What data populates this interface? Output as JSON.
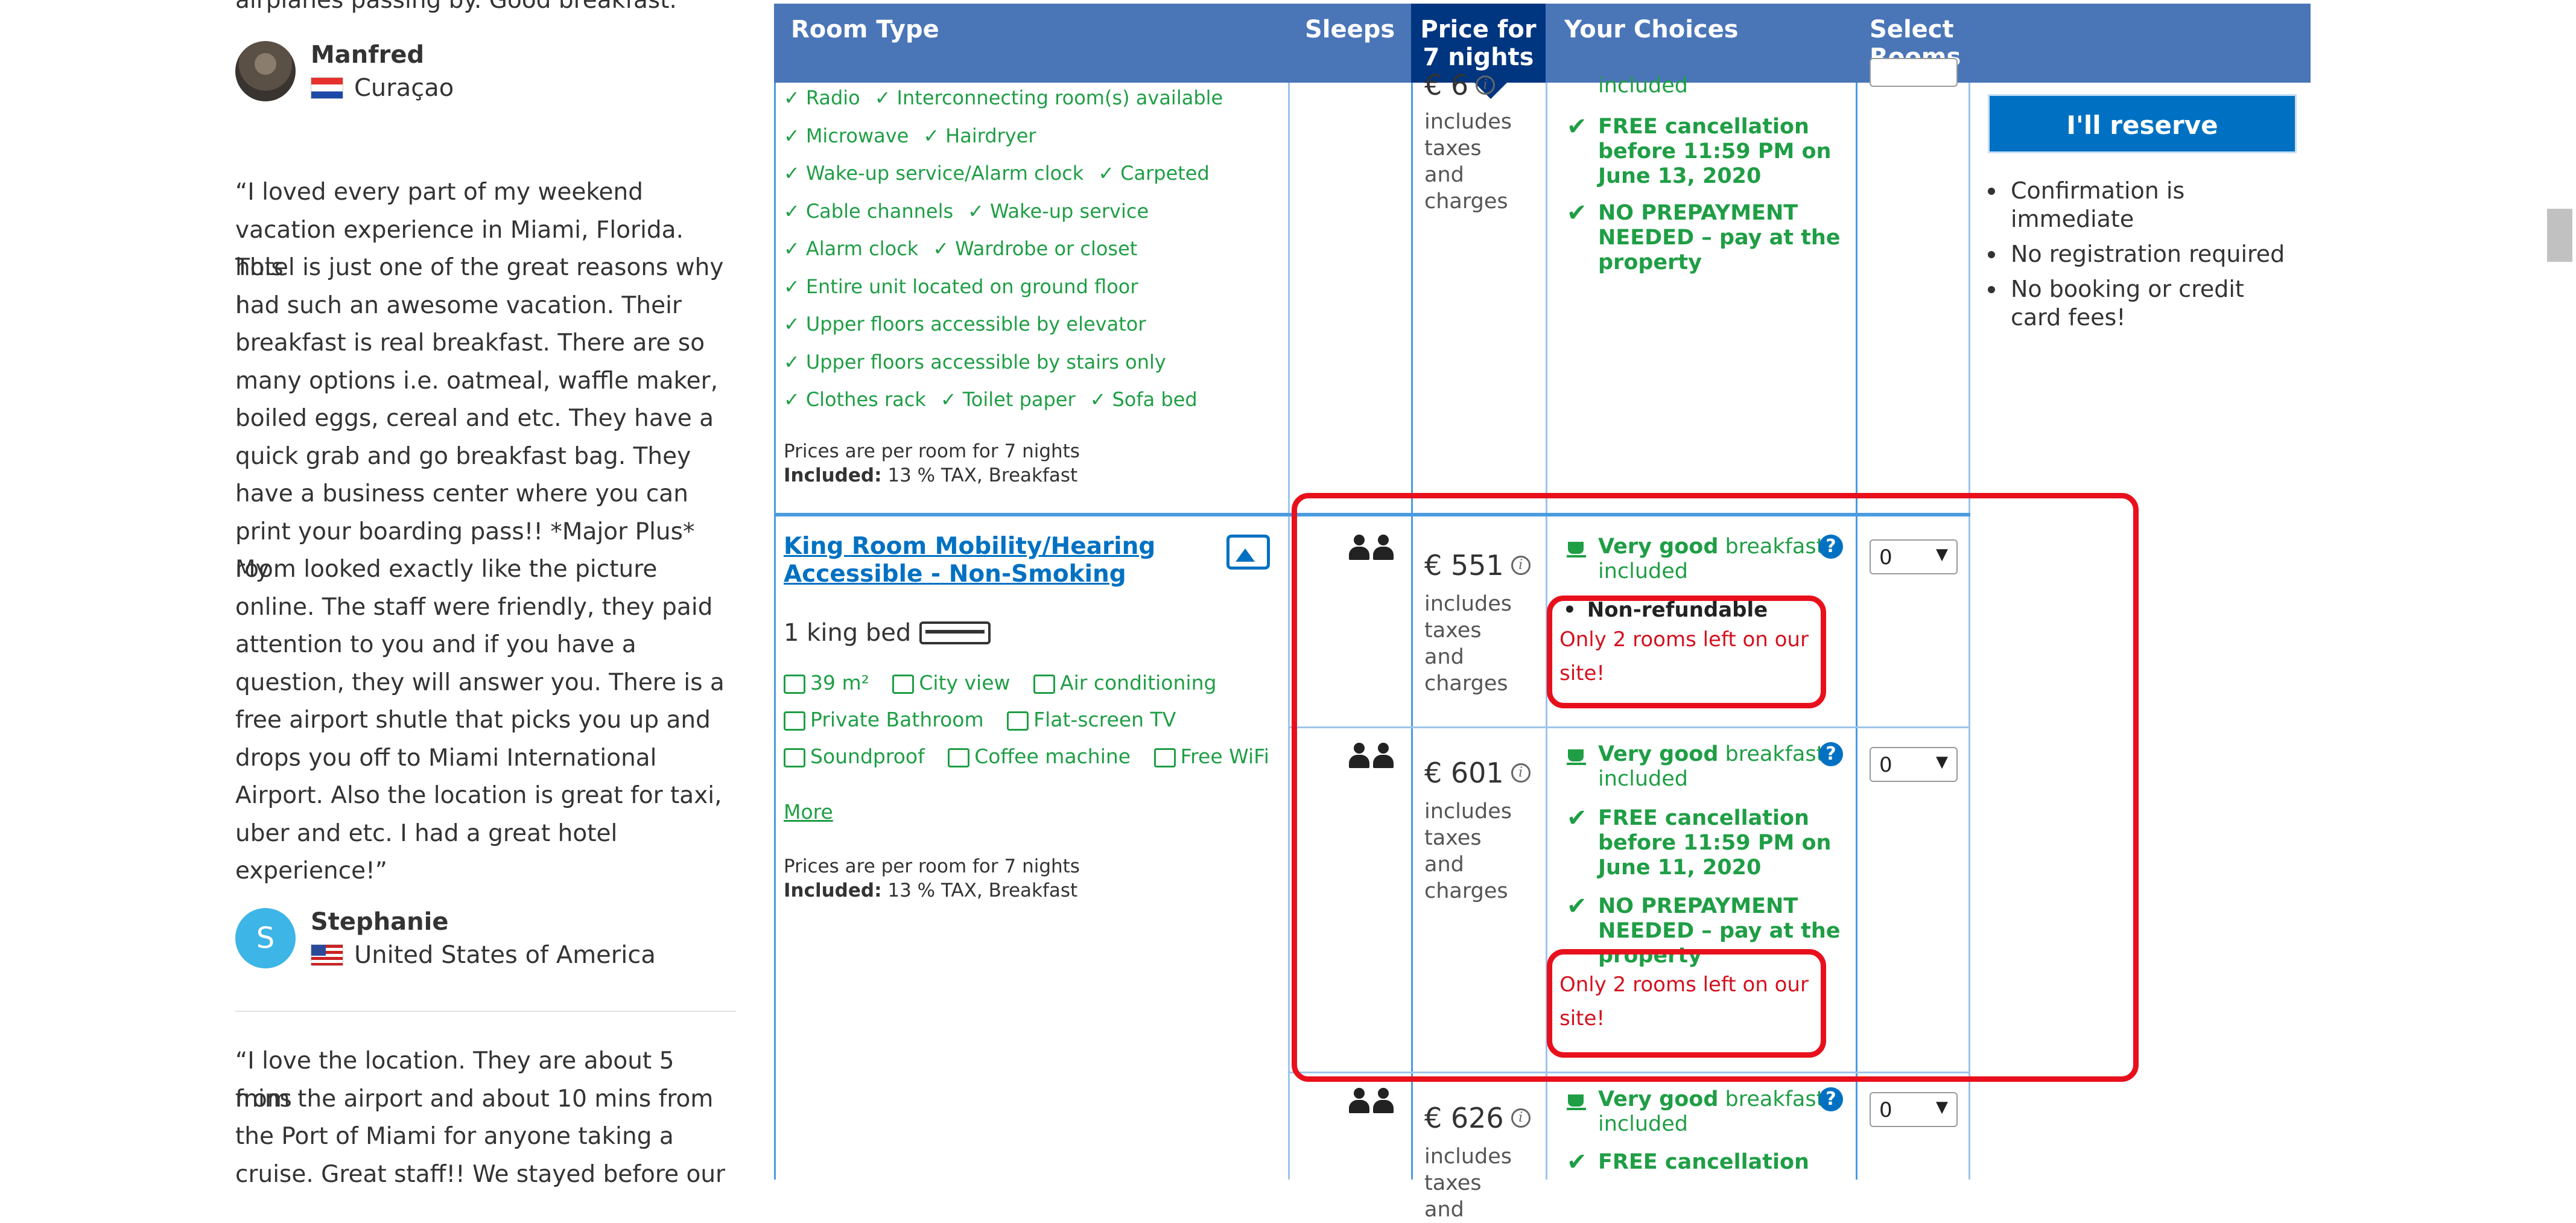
{
  "reviews": {
    "cut_text_top": "airplanes passing by. Good breakfast.",
    "reviewer1": {
      "name": "Manfred",
      "country": "Curaçao"
    },
    "review2_lines": [
      "“I loved every part of my weekend",
      "vacation experience in Miami, Florida. This",
      "hotel is just one of the great reasons why I",
      "had such an awesome vacation. Their",
      "breakfast is real breakfast. There are so",
      "many options i.e. oatmeal, waffle maker,",
      "boiled eggs, cereal and etc. They have a",
      "quick grab and go breakfast bag. They",
      "have a business center where you can",
      "print your boarding pass!! *Major Plus* My",
      "room looked exactly like the picture",
      "online. The staff were friendly, they paid",
      "attention to you and if you have a",
      "question, they will answer you. There is a",
      "free airport shutle that picks you up and",
      "drops you off to Miami International",
      "Airport. Also the location is great for taxi,",
      "uber and etc. I had a great hotel",
      "experience!”"
    ],
    "reviewer2": {
      "name": "Stephanie",
      "initial": "S",
      "country": "United States of America"
    },
    "review3_lines": [
      "“I love the location. They are about 5 mins",
      "from the airport and about 10 mins from",
      "the Port of Miami for anyone taking a",
      "cruise. Great staff!! We stayed before our"
    ]
  },
  "table": {
    "headers": {
      "room_type": "Room Type",
      "sleeps": "Sleeps",
      "price_line1": "Price for",
      "price_line2": "7 nights",
      "choices": "Your Choices",
      "select_line1": "Select",
      "select_line2": "Rooms"
    },
    "room1": {
      "price_partial": "€ 6",
      "included_partial": "included",
      "facility_rows": [
        [
          "Radio",
          "Interconnecting room(s) available"
        ],
        [
          "Microwave",
          "Hairdryer"
        ],
        [
          "Wake-up service/Alarm clock",
          "Carpeted"
        ],
        [
          "Cable channels",
          "Wake-up service"
        ],
        [
          "Alarm clock",
          "Wardrobe or closet"
        ],
        [
          "Entire unit located on ground floor"
        ],
        [
          "Upper floors accessible by elevator"
        ],
        [
          "Upper floors accessible by stairs only"
        ],
        [
          "Clothes rack",
          "Toilet paper",
          "Sofa bed"
        ]
      ],
      "prices_note": "Prices are per room for 7 nights",
      "included_label": "Included:",
      "included_value": "13 % TAX, Breakfast",
      "incl_text": "includes taxes and charges",
      "free_cancel": "FREE cancellation before 11:59 PM on June 13, 2020",
      "no_prepay": "NO PREPAYMENT NEEDED",
      "no_prepay_tail": " – pay at the property"
    },
    "room2": {
      "name": "King Room Mobility/Hearing Accessible - Non-Smoking",
      "bed": "1 king bed",
      "features_row1": [
        "39 m²",
        "City view",
        "Air conditioning"
      ],
      "features_row2": [
        "Private Bathroom",
        "Flat-screen TV"
      ],
      "features_row3": [
        "Soundproof",
        "Coffee machine",
        "Free WiFi"
      ],
      "more": "More",
      "prices_note": "Prices are per room for 7 nights",
      "included_label": "Included:",
      "included_value": "13 % TAX, Breakfast"
    },
    "options": [
      {
        "price": "€ 551",
        "incl": "includes taxes and charges",
        "breakfast_bold": "Very good",
        "breakfast_rest": " breakfast included",
        "nonref": "Non-refundable",
        "rooms_left": "Only 2 rooms left on our site!",
        "select_value": "0"
      },
      {
        "price": "€ 601",
        "incl": "includes taxes and charges",
        "breakfast_bold": "Very good",
        "breakfast_rest": " breakfast included",
        "free_cancel": "FREE cancellation before 11:59 PM on June 11, 2020",
        "no_prepay": "NO PREPAYMENT NEEDED",
        "no_prepay_tail": " – pay at the property",
        "rooms_left": "Only 2 rooms left on our site!",
        "select_value": "0"
      },
      {
        "price": "€ 626",
        "incl": "includes taxes and",
        "breakfast_bold": "Very good",
        "breakfast_rest": " breakfast included",
        "free_cancel": "FREE cancellation",
        "select_value": "0"
      }
    ],
    "reserve_button": "I'll reserve",
    "reserve_bullets": [
      "Confirmation is immediate",
      "No registration required",
      "No booking or credit card fees!"
    ]
  },
  "colors": {
    "header_bg": "#4a76b8",
    "price_header_bg": "#003580",
    "green": "#1f9e45",
    "link_blue": "#0071c2",
    "annotation_red": "#e8101c"
  }
}
